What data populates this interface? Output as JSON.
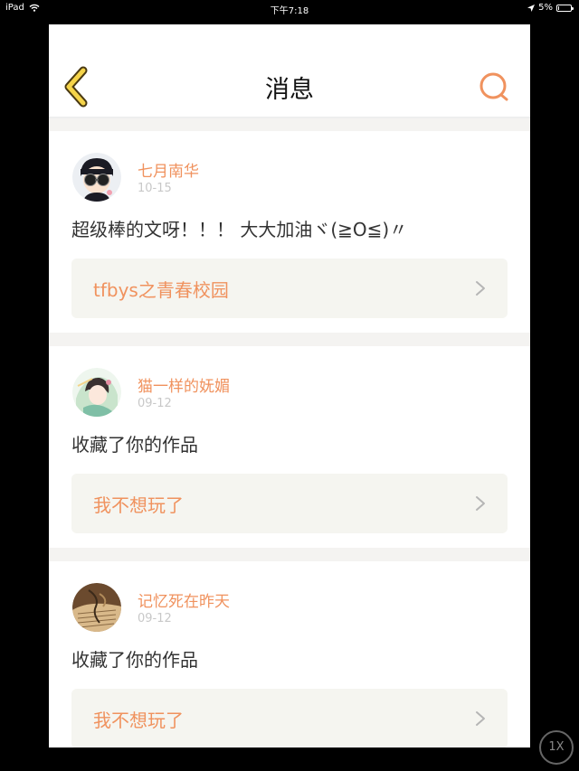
{
  "status_bar": {
    "device": "iPad",
    "time": "下午7:18",
    "battery_percent": "5%",
    "battery_level": 0.05
  },
  "nav": {
    "title": "消息",
    "back_icon": "chevron-left-icon",
    "search_icon": "search-icon",
    "accent": "#f0925e",
    "back_color": "#f5d44a"
  },
  "messages": [
    {
      "user": "七月南华",
      "date": "10-15",
      "text": "超级棒的文呀！！！ 大大加油ヾ(≧O≦)〃",
      "work": "tfbys之青春校园"
    },
    {
      "user": "猫一样的妩媚",
      "date": "09-12",
      "text": "收藏了你的作品",
      "work": "我不想玩了"
    },
    {
      "user": "记忆死在昨天",
      "date": "09-12",
      "text": "收藏了你的作品",
      "work": "我不想玩了"
    }
  ],
  "zoom": {
    "label": "1X"
  }
}
